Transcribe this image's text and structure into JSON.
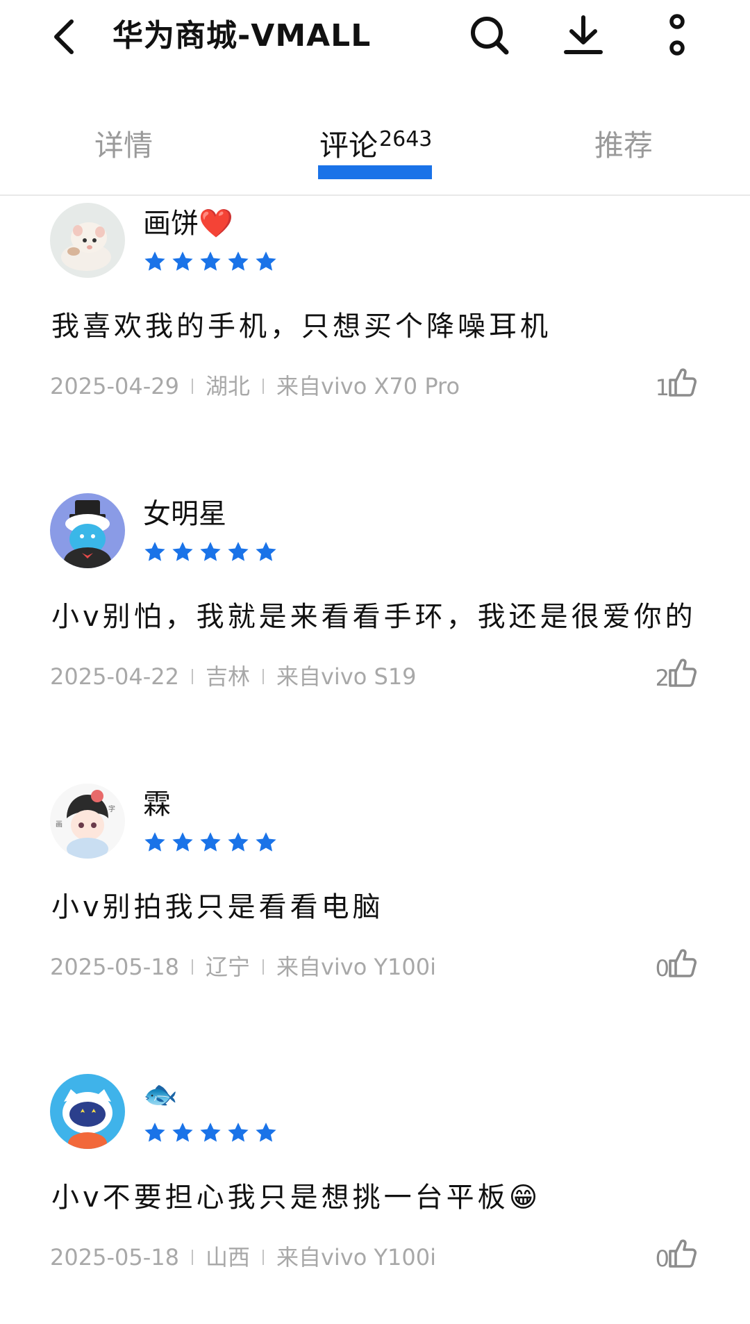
{
  "appbar": {
    "title": "华为商城-VMALL",
    "icons": [
      "back-arrow-icon",
      "search-icon",
      "download-icon",
      "more-vertical-icon"
    ]
  },
  "tabs": {
    "detail": "详情",
    "reviews": "评论",
    "reviews_count": "2643",
    "recommend": "推荐",
    "active": "reviews"
  },
  "colors": {
    "accent": "#1a73e8",
    "star": "#1a73e8",
    "meta_text": "#a8a8a8"
  },
  "reviews": [
    {
      "username": "画饼❤️",
      "stars": 5,
      "comment": "我喜欢我的手机，只想买个降噪耳机",
      "date": "2025-04-29",
      "region": "湖北",
      "device": "来自vivo X70 Pro",
      "likes": "1"
    },
    {
      "username": "女明星",
      "stars": 5,
      "comment": "小v别怕，我就是来看看手环，我还是很爱你的",
      "date": "2025-04-22",
      "region": "吉林",
      "device": "来自vivo S19",
      "likes": "2"
    },
    {
      "username": "霖",
      "stars": 5,
      "comment": "小v别拍我只是看看电脑",
      "date": "2025-05-18",
      "region": "辽宁",
      "device": "来自vivo Y100i",
      "likes": "0"
    },
    {
      "username": "🐟",
      "stars": 5,
      "comment": "小v不要担心我只是想挑一台平板😁",
      "date": "2025-05-18",
      "region": "山西",
      "device": "来自vivo Y100i",
      "likes": "0"
    }
  ]
}
